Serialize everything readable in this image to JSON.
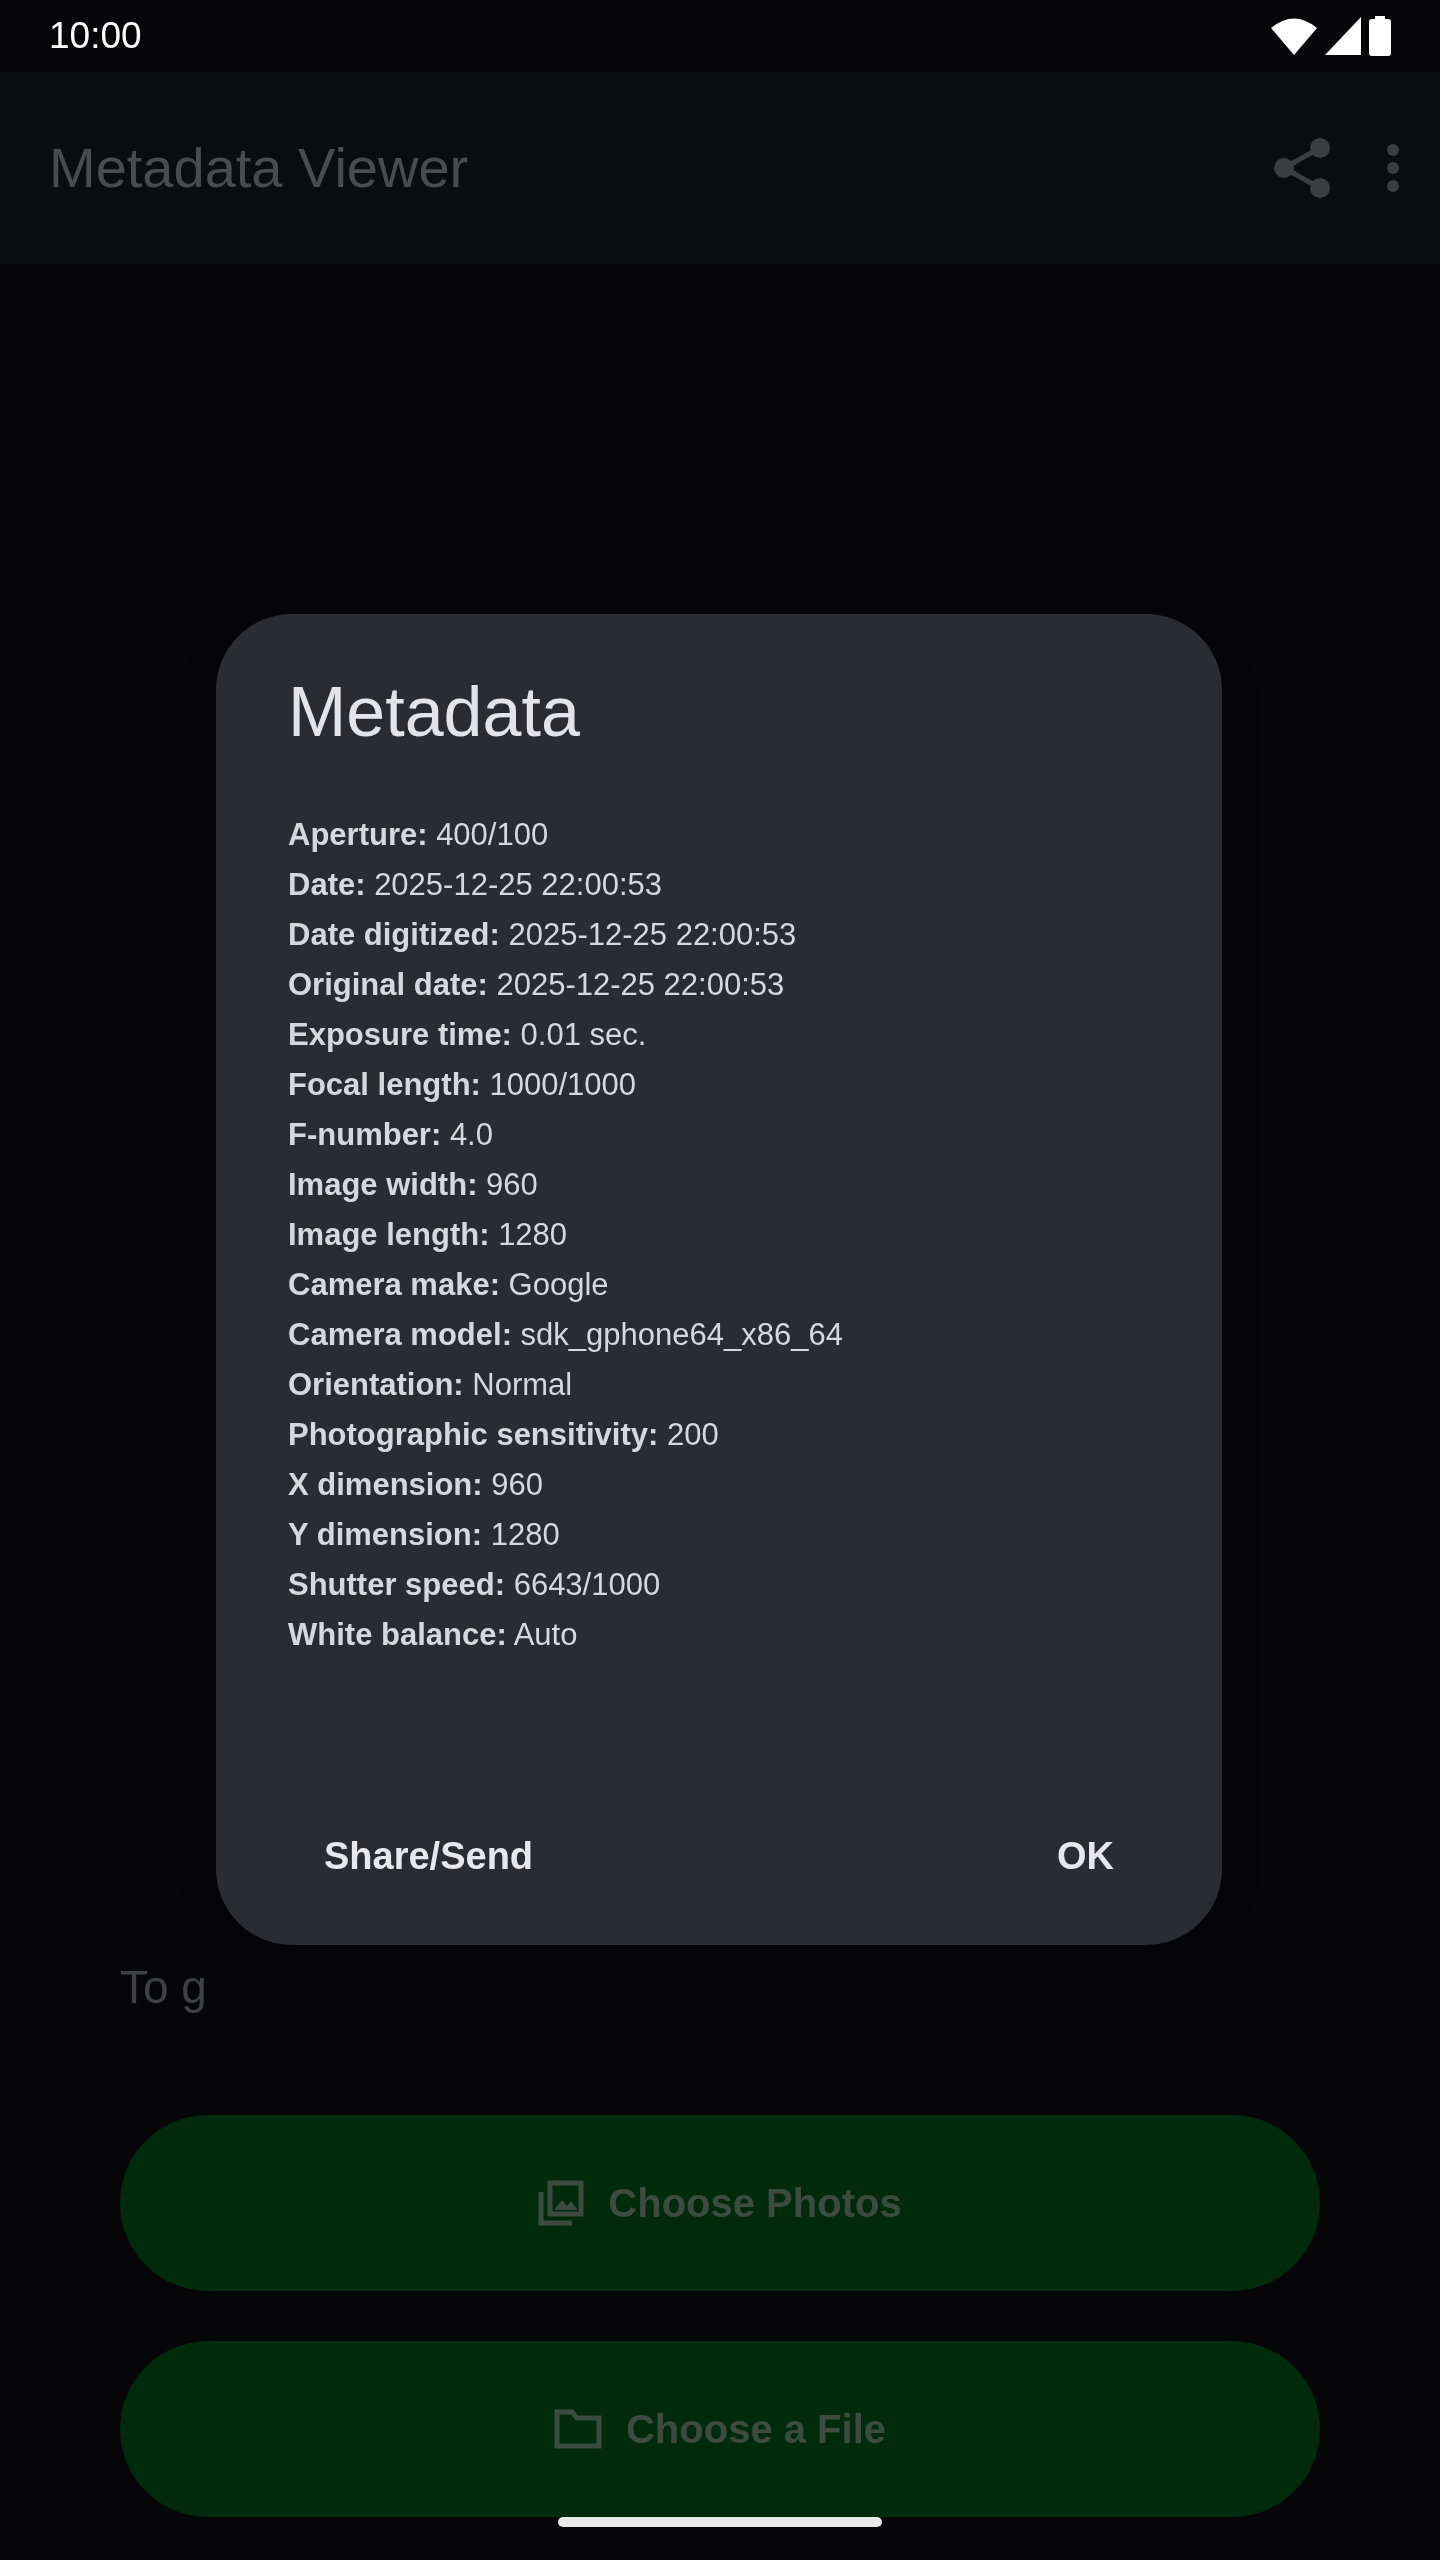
{
  "status_bar": {
    "time": "10:00"
  },
  "app_bar": {
    "title": "Metadata Viewer"
  },
  "content": {
    "hint": "To g",
    "buttons": [
      {
        "label": "Choose Photos",
        "kind": "photos"
      },
      {
        "label": "Choose a File",
        "kind": "file"
      }
    ]
  },
  "dialog": {
    "title": "Metadata",
    "fields": [
      {
        "label": "Aperture:",
        "value": "400/100"
      },
      {
        "label": "Date:",
        "value": "2025-12-25 22:00:53"
      },
      {
        "label": "Date digitized:",
        "value": "2025-12-25 22:00:53"
      },
      {
        "label": "Original date:",
        "value": "2025-12-25 22:00:53"
      },
      {
        "label": "Exposure time:",
        "value": "0.01 sec."
      },
      {
        "label": "Focal length:",
        "value": "1000/1000"
      },
      {
        "label": "F-number:",
        "value": "4.0"
      },
      {
        "label": "Image width:",
        "value": "960"
      },
      {
        "label": "Image length:",
        "value": "1280"
      },
      {
        "label": "Camera make:",
        "value": "Google"
      },
      {
        "label": "Camera model:",
        "value": "sdk_gphone64_x86_64"
      },
      {
        "label": "Orientation:",
        "value": "Normal"
      },
      {
        "label": "Photographic sensitivity:",
        "value": "200"
      },
      {
        "label": "X dimension:",
        "value": "960"
      },
      {
        "label": "Y dimension:",
        "value": "1280"
      },
      {
        "label": "Shutter speed:",
        "value": "6643/1000"
      },
      {
        "label": "White balance:",
        "value": "Auto"
      }
    ],
    "buttons": [
      "Share/Send",
      "OK"
    ]
  }
}
